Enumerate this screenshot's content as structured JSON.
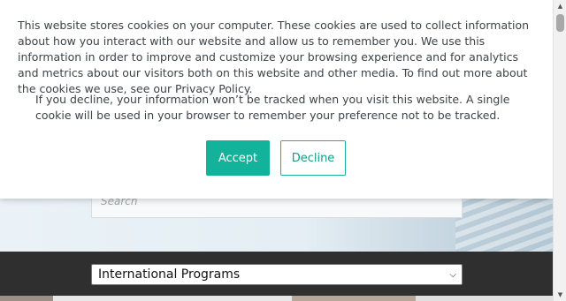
{
  "cookie_banner": {
    "message": "This website stores cookies on your computer. These cookies are used to collect information about how you interact with our website and allow us to remember you. We use this information in order to improve and customize your browsing experience and for analytics and metrics about our visitors both on this website and other media. To find out more about the cookies we use, see our Privacy Policy.",
    "decline_note": "If you decline, your information won’t be tracked when you visit this website. A single cookie will be used in your browser to remember your preference not to be tracked.",
    "accept_label": "Accept",
    "decline_label": "Decline",
    "accent_color": "#12b39a"
  },
  "search": {
    "placeholder": "Search"
  },
  "program_select": {
    "selected": "International Programs"
  },
  "scrollbar": {
    "up_icon": "triangle-up-icon",
    "down_icon": "triangle-down-icon"
  }
}
